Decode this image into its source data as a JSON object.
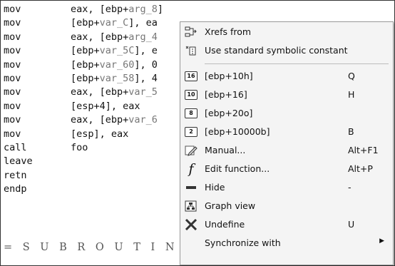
{
  "listing": [
    {
      "mn": "mov",
      "ops": [
        {
          "t": "eax, [ebp+"
        },
        {
          "t": "arg_8",
          "s": true
        },
        {
          "t": "]"
        }
      ]
    },
    {
      "mn": "mov",
      "ops": [
        {
          "t": "[ebp+"
        },
        {
          "t": "var_C",
          "s": true
        },
        {
          "t": "], ea"
        }
      ]
    },
    {
      "mn": "mov",
      "ops": [
        {
          "t": "eax, [ebp+"
        },
        {
          "t": "arg_4",
          "s": true
        }
      ]
    },
    {
      "mn": "mov",
      "ops": [
        {
          "t": "[ebp+"
        },
        {
          "t": "var_5C",
          "s": true
        },
        {
          "t": "], e"
        }
      ]
    },
    {
      "mn": "mov",
      "ops": [
        {
          "t": "[ebp+"
        },
        {
          "t": "var_60",
          "s": true
        },
        {
          "t": "], 0"
        }
      ]
    },
    {
      "mn": "mov",
      "ops": [
        {
          "t": "[ebp+"
        },
        {
          "t": "var_58",
          "s": true
        },
        {
          "t": "], 4"
        }
      ]
    },
    {
      "mn": "mov",
      "ops": [
        {
          "t": "eax, [ebp+"
        },
        {
          "t": "var_5",
          "s": true
        }
      ]
    },
    {
      "mn": "mov",
      "ops": [
        {
          "t": "[esp+4], eax"
        }
      ]
    },
    {
      "mn": "mov",
      "ops": [
        {
          "t": "eax, [ebp+"
        },
        {
          "t": "var_6",
          "s": true
        }
      ]
    },
    {
      "mn": "mov",
      "ops": [
        {
          "t": "[esp], eax"
        }
      ]
    },
    {
      "mn": "call",
      "ops": [
        {
          "t": "foo"
        }
      ]
    },
    {
      "mn": "leave",
      "ops": []
    },
    {
      "mn": "retn",
      "ops": []
    },
    {
      "mn": "endp",
      "ops": []
    }
  ],
  "subroutine_banner": "= S U B R O U T I N E =",
  "menu": {
    "xrefs_from": "Xrefs from",
    "use_symbolic": "Use standard symbolic constant",
    "hex": {
      "label": "[ebp+10h]",
      "shortcut": "Q",
      "icon": "16"
    },
    "dec": {
      "label": "[ebp+16]",
      "shortcut": "H",
      "icon": "10"
    },
    "oct": {
      "label": "[ebp+20o]",
      "shortcut": "",
      "icon": "8"
    },
    "bin": {
      "label": "[ebp+10000b]",
      "shortcut": "B",
      "icon": "2"
    },
    "manual": {
      "label": "Manual...",
      "shortcut": "Alt+F1"
    },
    "edit_function": {
      "label": "Edit function...",
      "shortcut": "Alt+P"
    },
    "hide": {
      "label": "Hide",
      "shortcut": "-"
    },
    "graph_view": {
      "label": "Graph view"
    },
    "undefine": {
      "label": "Undefine",
      "shortcut": "U"
    },
    "synchronize": {
      "label": "Synchronize with"
    }
  }
}
